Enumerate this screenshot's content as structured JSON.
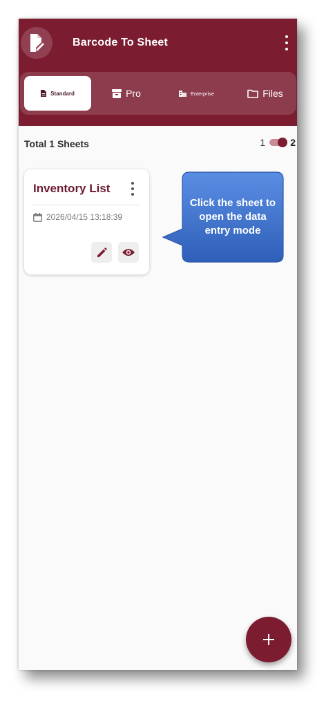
{
  "app": {
    "title": "Barcode To Sheet",
    "colors": {
      "primary": "#7b1c31",
      "callout": "#3a6fcd",
      "background": "#fafafa"
    }
  },
  "tabs": [
    {
      "label": "Standard",
      "icon": "document-icon",
      "active": true
    },
    {
      "label": "Pro",
      "icon": "archive-icon",
      "active": false
    },
    {
      "label": "Enterprise",
      "icon": "building-icon",
      "active": false
    },
    {
      "label": "Files",
      "icon": "folder-icon",
      "active": false
    }
  ],
  "summary": {
    "label": "Total 1 Sheets",
    "toggle_left": "1",
    "toggle_right": "2"
  },
  "sheets": [
    {
      "title": "Inventory List",
      "date": "2026/04/15 13:18:39"
    }
  ],
  "callout": {
    "text": "Click the sheet to open the data entry mode"
  },
  "fab": {
    "icon": "plus-icon"
  }
}
